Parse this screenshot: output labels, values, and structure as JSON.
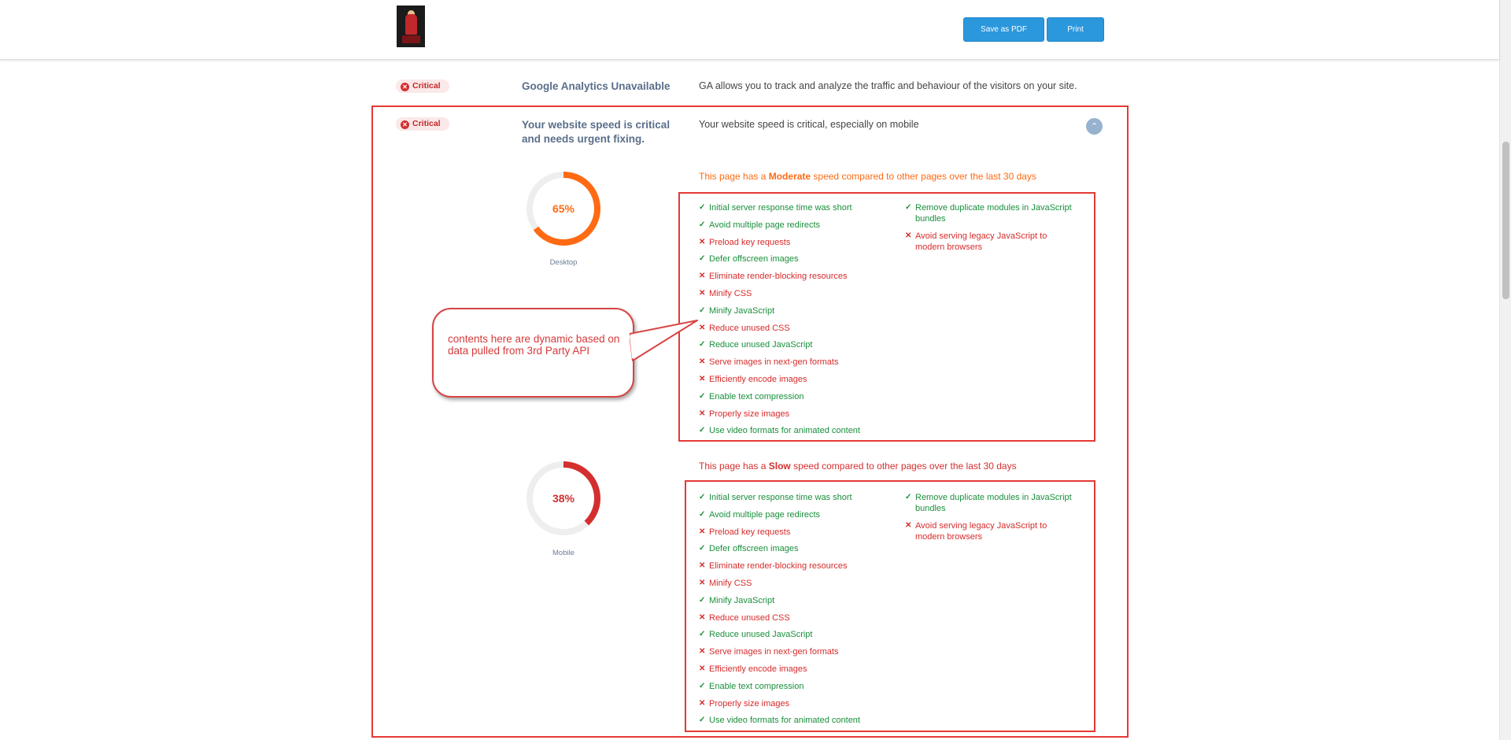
{
  "header": {
    "save_pdf_label": "Save as PDF",
    "print_label": "Print"
  },
  "rows": [
    {
      "badge": "Critical",
      "title": "Google Analytics Unavailable",
      "description": "GA allows you to track and analyze the traffic and behaviour of the visitors on your site."
    },
    {
      "badge": "Critical",
      "title_line1": "Your website speed is critical",
      "title_line2": "and needs urgent fixing.",
      "description": "Your website speed is critical, especially on mobile"
    }
  ],
  "desktop": {
    "score_text": "65%",
    "score": 0.65,
    "label": "Desktop",
    "color": "#ff6a13",
    "speed_prefix": "This page has a ",
    "speed_word": "Moderate",
    "speed_suffix": " speed compared to other pages over the last 30 days"
  },
  "mobile": {
    "score_text": "38%",
    "score": 0.38,
    "label": "Mobile",
    "color": "#d32f2f",
    "speed_prefix": "This page has a ",
    "speed_word": "Slow",
    "speed_suffix": " speed compared to other pages over the last 30 days"
  },
  "audits_col1": [
    {
      "text": "Initial server response time was short",
      "status": "pass"
    },
    {
      "text": "Avoid multiple page redirects",
      "status": "pass"
    },
    {
      "text": "Preload key requests",
      "status": "fail"
    },
    {
      "text": "Defer offscreen images",
      "status": "pass"
    },
    {
      "text": "Eliminate render-blocking resources",
      "status": "fail"
    },
    {
      "text": "Minify CSS",
      "status": "fail"
    },
    {
      "text": "Minify JavaScript",
      "status": "pass"
    },
    {
      "text": "Reduce unused CSS",
      "status": "fail"
    },
    {
      "text": "Reduce unused JavaScript",
      "status": "pass"
    },
    {
      "text": "Serve images in next-gen formats",
      "status": "fail"
    },
    {
      "text": "Efficiently encode images",
      "status": "fail"
    },
    {
      "text": "Enable text compression",
      "status": "pass"
    },
    {
      "text": "Properly size images",
      "status": "fail"
    },
    {
      "text": "Use video formats for animated content",
      "status": "pass"
    }
  ],
  "audits_col2": [
    {
      "text": "Remove duplicate modules in JavaScript bundles",
      "status": "pass"
    },
    {
      "text": "Avoid serving legacy JavaScript to modern browsers",
      "status": "fail"
    }
  ],
  "marks": {
    "pass": "✓",
    "fail": "✕"
  },
  "callout": {
    "text": "contents here are dynamic based on data pulled from 3rd Party API"
  },
  "colors": {
    "critical": "#c0282b",
    "annotation": "#e53935",
    "button": "#2b97dc",
    "pass": "#1a8f3c",
    "fail": "#d62b2b"
  }
}
